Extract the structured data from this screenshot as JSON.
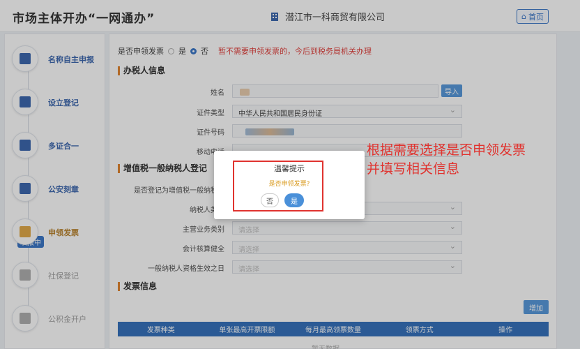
{
  "header": {
    "app_title": "市场主体开办“一网通办”",
    "company": "潜江市一科商贸有限公司",
    "home_label": "首页"
  },
  "sidebar": {
    "items": [
      {
        "label": "名称自主申报",
        "icon": "name-report-icon",
        "color": "#2b5aa8"
      },
      {
        "label": "设立登记",
        "icon": "register-icon",
        "color": "#2b5aa8"
      },
      {
        "label": "多证合一",
        "icon": "multi-cert-icon",
        "color": "#2b5aa8"
      },
      {
        "label": "公安刻章",
        "icon": "seal-icon",
        "color": "#2b5aa8"
      },
      {
        "label": "申领发票",
        "icon": "invoice-icon",
        "color": "#b47a1e"
      },
      {
        "label": "社保登记",
        "icon": "social-security-icon",
        "color": "#999999"
      },
      {
        "label": "公积金开户",
        "icon": "housing-fund-icon",
        "color": "#999999"
      }
    ],
    "badge": "填报中"
  },
  "form": {
    "invoice_question": "是否申领发票",
    "option_yes": "是",
    "option_no": "否",
    "invoice_note": "暂不需要申领发票的，今后到税务局机关办理",
    "section_tax_person": "办税人信息",
    "name_label": "姓名",
    "import_label": "导入",
    "id_type_label": "证件类型",
    "id_type_value": "中华人民共和国居民身份证",
    "id_number_label": "证件号码",
    "mobile_label": "移动电话",
    "section_vat": "增值税一般纳税人登记",
    "vat_register_label": "是否登记为增值税一般纳税人",
    "taxpayer_label": "纳税人类别",
    "main_business_label": "主营业务类别",
    "accounting_label": "会计核算健全",
    "effective_date_label": "一般纳税人资格生效之日",
    "select_placeholder": "请选择",
    "section_invoice": "发票信息",
    "add_label": "增加",
    "table_headers": [
      "发票种类",
      "单张最高开票限额",
      "每月最高领票数量",
      "领票方式",
      "操作"
    ],
    "no_data": "暂无数据"
  },
  "dialog": {
    "title": "温馨提示",
    "question": "是否申领发票?",
    "no_label": "否",
    "yes_label": "是"
  },
  "annotation": {
    "line1": "根据需要选择是否申领发票",
    "line2": "并填写相关信息"
  }
}
